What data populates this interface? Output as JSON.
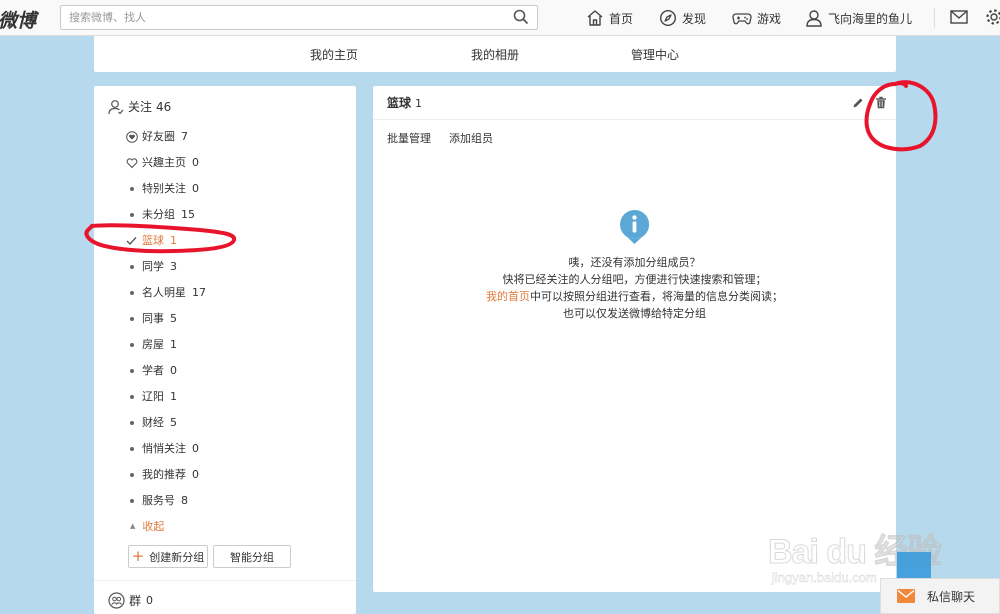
{
  "topbar": {
    "logo": "微博",
    "search_placeholder": "搜索微博、找人",
    "nav": {
      "home": "首页",
      "discover": "发现",
      "games": "游戏",
      "user": "飞向海里的鱼儿"
    }
  },
  "profile_tabs": [
    "我的主页",
    "我的相册",
    "管理中心"
  ],
  "sidebar": {
    "follow_label": "关注",
    "follow_count": "46",
    "groups": [
      {
        "label": "好友圈",
        "count": "7"
      },
      {
        "label": "兴趣主页",
        "count": "0"
      },
      {
        "label": "特别关注",
        "count": "0"
      },
      {
        "label": "未分组",
        "count": "15"
      },
      {
        "label": "篮球",
        "count": "1"
      },
      {
        "label": "同学",
        "count": "3"
      },
      {
        "label": "名人明星",
        "count": "17"
      },
      {
        "label": "同事",
        "count": "5"
      },
      {
        "label": "房屋",
        "count": "1"
      },
      {
        "label": "学者",
        "count": "0"
      },
      {
        "label": "辽阳",
        "count": "1"
      },
      {
        "label": "财经",
        "count": "5"
      },
      {
        "label": "悄悄关注",
        "count": "0"
      },
      {
        "label": "我的推荐",
        "count": "0"
      },
      {
        "label": "服务号",
        "count": "8"
      }
    ],
    "collapse_label": "收起",
    "create_group_label": "创建新分组",
    "smart_group_label": "智能分组",
    "qun_label": "群",
    "qun_count": "0"
  },
  "main": {
    "title": "篮球",
    "count": "1",
    "actions": {
      "batch": "批量管理",
      "add_member": "添加组员"
    },
    "empty": {
      "line1": "咦，还没有添加分组成员？",
      "line2": "快将已经关注的人分组吧，方便进行快速搜索和管理；",
      "line3_link": "我的首页",
      "line3_rest": "中可以按照分组进行查看，将海量的信息分类阅读；",
      "line4": "也可以仅发送微博给特定分组"
    }
  },
  "watermark": {
    "main": "Bai du 经验",
    "sub": "jingyan.baidu.com"
  },
  "chat": {
    "label": "私信聊天"
  },
  "colors": {
    "accent": "#e07a3b",
    "page_bg": "#b7d9ee",
    "annotation": "#e8142b",
    "info": "#5ba7d6"
  }
}
